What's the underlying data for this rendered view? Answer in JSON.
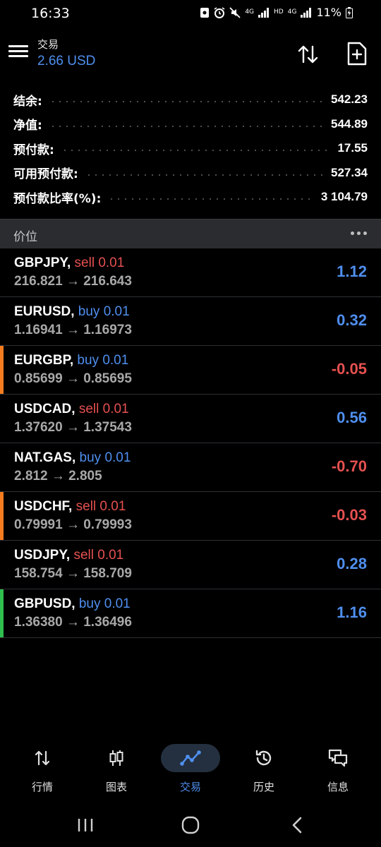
{
  "status": {
    "time": "16:33",
    "signal_label_1": "4G",
    "hd_label": "HD",
    "signal_label_2": "4G",
    "battery": "11%"
  },
  "header": {
    "title": "交易",
    "profit": "2.66 USD"
  },
  "summary": [
    {
      "label": "结余:",
      "value": "542.23"
    },
    {
      "label": "净值:",
      "value": "544.89"
    },
    {
      "label": "预付款:",
      "value": "17.55"
    },
    {
      "label": "可用预付款:",
      "value": "527.34"
    },
    {
      "label": "预付款比率(%):",
      "value": "3 104.79"
    }
  ],
  "section": {
    "title": "价位"
  },
  "positions": [
    {
      "symbol": "GBPJPY,",
      "side": "sell 0.01",
      "prices": "216.821 → 216.643",
      "profit": "1.12",
      "accent": ""
    },
    {
      "symbol": "EURUSD,",
      "side": "buy 0.01",
      "prices": "1.16941 → 1.16973",
      "profit": "0.32",
      "accent": ""
    },
    {
      "symbol": "EURGBP,",
      "side": "buy 0.01",
      "prices": "0.85699 → 0.85695",
      "profit": "-0.05",
      "accent": "#f57c1f"
    },
    {
      "symbol": "USDCAD,",
      "side": "sell 0.01",
      "prices": "1.37620 → 1.37543",
      "profit": "0.56",
      "accent": ""
    },
    {
      "symbol": "NAT.GAS,",
      "side": "buy 0.01",
      "prices": "2.812 → 2.805",
      "profit": "-0.70",
      "accent": ""
    },
    {
      "symbol": "USDCHF,",
      "side": "sell 0.01",
      "prices": "0.79991 → 0.79993",
      "profit": "-0.03",
      "accent": "#f57c1f"
    },
    {
      "symbol": "USDJPY,",
      "side": "sell 0.01",
      "prices": "158.754 → 158.709",
      "profit": "0.28",
      "accent": ""
    },
    {
      "symbol": "GBPUSD,",
      "side": "buy 0.01",
      "prices": "1.36380 → 1.36496",
      "profit": "1.16",
      "accent": "#2fbf4f"
    }
  ],
  "nav": {
    "quotes": "行情",
    "charts": "图表",
    "trade": "交易",
    "history": "历史",
    "messages": "信息"
  },
  "colors": {
    "accent_blue": "#4f8fef",
    "loss_red": "#e65050",
    "warning_orange": "#f57c1f",
    "ok_green": "#2fbf4f"
  }
}
